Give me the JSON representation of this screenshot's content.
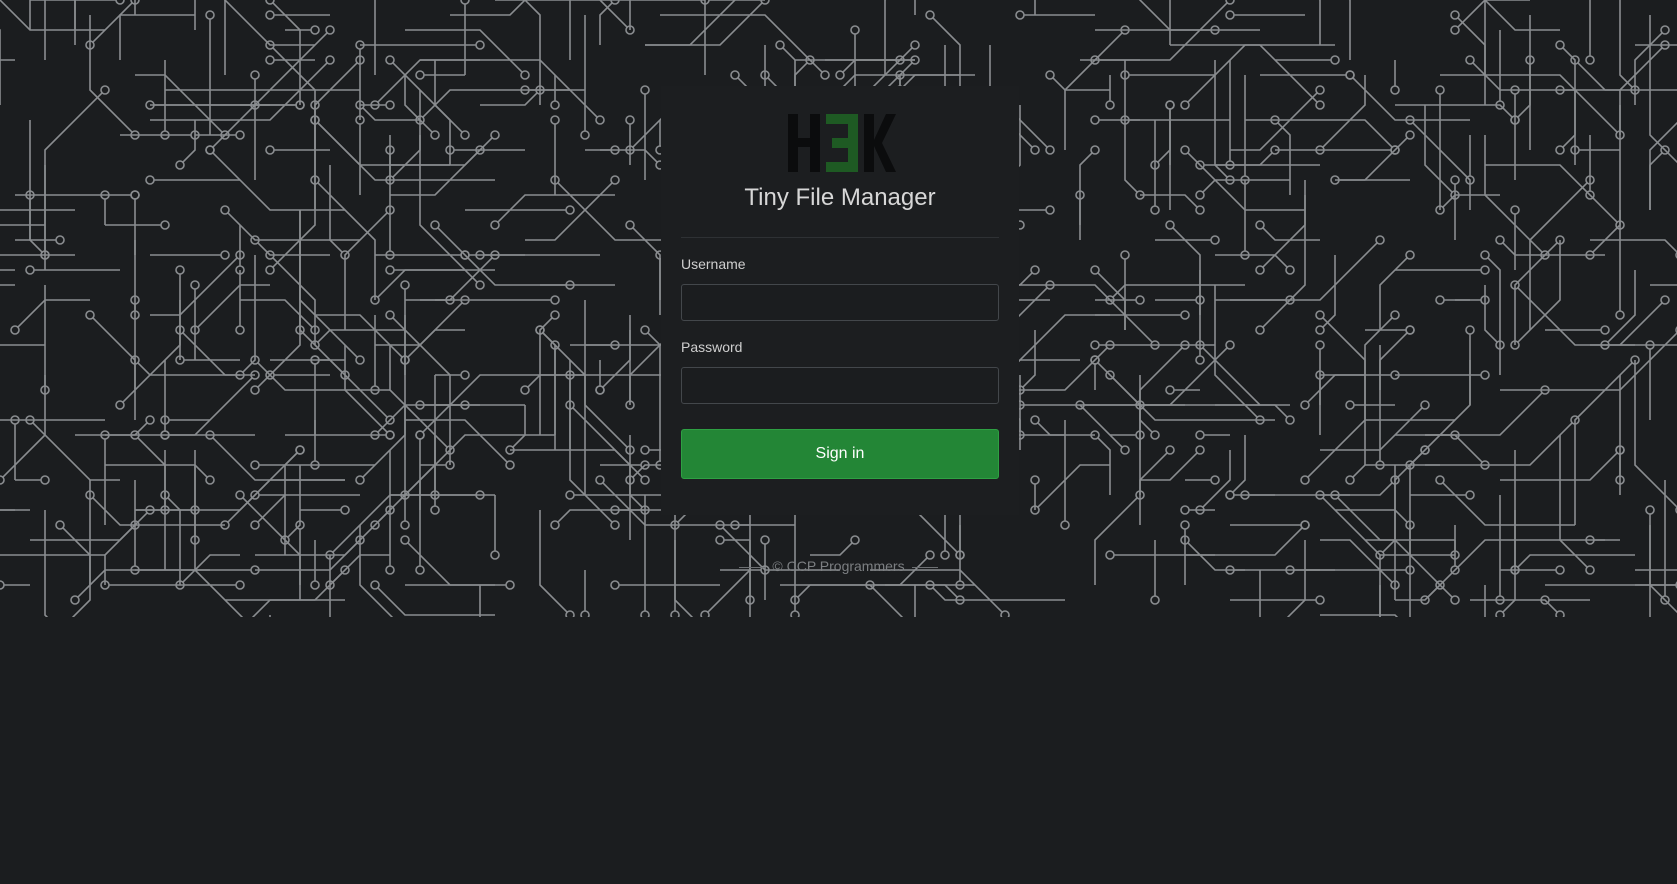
{
  "app": {
    "title": "Tiny File Manager",
    "logo_text": "H3K"
  },
  "form": {
    "username_label": "Username",
    "username_value": "",
    "password_label": "Password",
    "password_value": "",
    "submit_label": "Sign in"
  },
  "footer": {
    "text": "© CCP Programmers"
  },
  "colors": {
    "background": "#1b1d1f",
    "card": "#1c1e20",
    "circuit_lines": "#8a8d90",
    "button": "#238636",
    "logo_dark": "#0b0c0d",
    "logo_green": "#1e5a23"
  }
}
